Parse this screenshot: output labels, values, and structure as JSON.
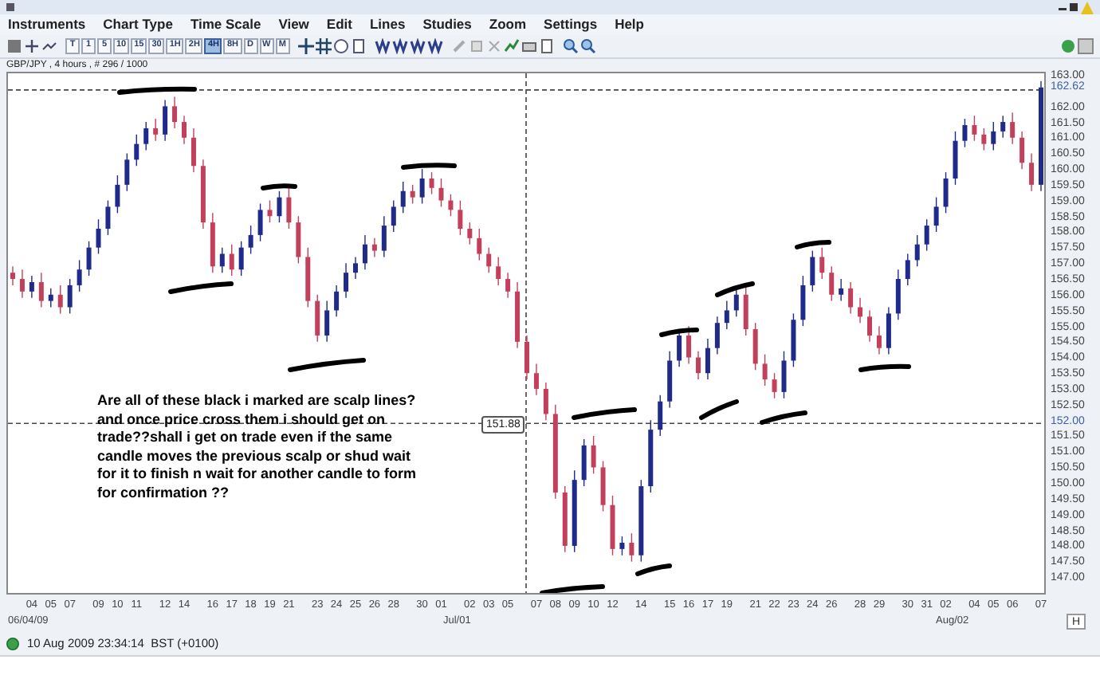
{
  "menu": [
    "Instruments",
    "Chart Type",
    "Time Scale",
    "View",
    "Edit",
    "Lines",
    "Studies",
    "Zoom",
    "Settings",
    "Help"
  ],
  "timeframes": [
    {
      "label": "T",
      "selected": false
    },
    {
      "label": "1",
      "selected": false
    },
    {
      "label": "5",
      "selected": false
    },
    {
      "label": "10",
      "selected": false
    },
    {
      "label": "15",
      "selected": false
    },
    {
      "label": "30",
      "selected": false
    },
    {
      "label": "1H",
      "selected": false
    },
    {
      "label": "2H",
      "selected": false
    },
    {
      "label": "4H",
      "selected": true
    },
    {
      "label": "8H",
      "selected": false
    },
    {
      "label": "D",
      "selected": false
    },
    {
      "label": "W",
      "selected": false
    },
    {
      "label": "M",
      "selected": false
    }
  ],
  "chart": {
    "heading": "GBP/JPY , 4 hours , # 296 / 1000",
    "chart_data": {
      "type": "candlestick",
      "ylim": [
        146.6,
        163.15
      ],
      "categories": [
        null,
        null,
        "04",
        null,
        "05",
        null,
        "07",
        null,
        null,
        "09",
        null,
        "10",
        null,
        "11",
        null,
        null,
        "12",
        null,
        "14",
        null,
        null,
        "16",
        null,
        "17",
        null,
        "18",
        null,
        "19",
        null,
        "21",
        null,
        null,
        "23",
        null,
        "24",
        null,
        "25",
        null,
        "26",
        null,
        "28",
        null,
        null,
        "30",
        null,
        "01",
        null,
        null,
        "02",
        null,
        "03",
        null,
        "05",
        null,
        null,
        "07",
        null,
        "08",
        null,
        "09",
        null,
        "10",
        null,
        "12",
        null,
        null,
        "14",
        null,
        null,
        "15",
        null,
        "16",
        null,
        "17",
        null,
        "19",
        null,
        null,
        "21",
        null,
        "22",
        null,
        "23",
        null,
        "24",
        null,
        "26",
        null,
        null,
        "28",
        null,
        "29",
        null,
        null,
        "30",
        null,
        "31",
        null,
        "02",
        null,
        null,
        "04",
        null,
        "05",
        null,
        "06",
        null,
        null,
        "07"
      ],
      "yticks": [
        {
          "value": 163,
          "label": "163.00"
        },
        {
          "value": 162,
          "label": "162.00"
        },
        {
          "value": 161.5,
          "label": "161.50"
        },
        {
          "value": 161,
          "label": "161.00"
        },
        {
          "value": 160.5,
          "label": "160.50"
        },
        {
          "value": 160,
          "label": "160.00"
        },
        {
          "value": 159.5,
          "label": "159.50"
        },
        {
          "value": 159,
          "label": "159.00"
        },
        {
          "value": 158.5,
          "label": "158.50"
        },
        {
          "value": 158,
          "label": "158.00"
        },
        {
          "value": 157.5,
          "label": "157.50"
        },
        {
          "value": 157,
          "label": "157.00"
        },
        {
          "value": 156.5,
          "label": "156.50"
        },
        {
          "value": 156,
          "label": "156.00"
        },
        {
          "value": 155.5,
          "label": "155.50"
        },
        {
          "value": 155,
          "label": "155.00"
        },
        {
          "value": 154.5,
          "label": "154.50"
        },
        {
          "value": 154,
          "label": "154.00"
        },
        {
          "value": 153.5,
          "label": "153.50"
        },
        {
          "value": 153,
          "label": "153.00"
        },
        {
          "value": 152.5,
          "label": "152.50"
        },
        {
          "value": 151.5,
          "label": "151.50"
        },
        {
          "value": 151,
          "label": "151.00"
        },
        {
          "value": 150.5,
          "label": "150.50"
        },
        {
          "value": 150,
          "label": "150.00"
        },
        {
          "value": 149.5,
          "label": "149.50"
        },
        {
          "value": 149,
          "label": "149.00"
        },
        {
          "value": 148.5,
          "label": "148.50"
        },
        {
          "value": 148,
          "label": "148.00"
        },
        {
          "value": 147.5,
          "label": "147.50"
        },
        {
          "value": 147,
          "label": "147.00"
        }
      ],
      "ohlc": [
        [
          156.8,
          157.0,
          156.4,
          156.6
        ],
        [
          156.6,
          156.9,
          156.0,
          156.2
        ],
        [
          156.2,
          156.7,
          156.0,
          156.5
        ],
        [
          156.5,
          156.8,
          155.7,
          155.9
        ],
        [
          155.9,
          156.3,
          155.7,
          156.1
        ],
        [
          156.1,
          156.4,
          155.5,
          155.7
        ],
        [
          155.7,
          156.6,
          155.5,
          156.4
        ],
        [
          156.4,
          157.2,
          156.2,
          156.9
        ],
        [
          156.9,
          157.8,
          156.7,
          157.6
        ],
        [
          157.6,
          158.5,
          157.4,
          158.2
        ],
        [
          158.2,
          159.1,
          158.0,
          158.9
        ],
        [
          158.9,
          159.9,
          158.7,
          159.6
        ],
        [
          159.6,
          160.6,
          159.4,
          160.4
        ],
        [
          160.4,
          161.2,
          160.2,
          160.9
        ],
        [
          160.9,
          161.6,
          160.7,
          161.4
        ],
        [
          161.4,
          161.7,
          161.0,
          161.2
        ],
        [
          161.2,
          162.3,
          161.0,
          162.1
        ],
        [
          162.1,
          162.4,
          161.4,
          161.6
        ],
        [
          161.6,
          161.8,
          160.9,
          161.1
        ],
        [
          161.1,
          161.4,
          160.0,
          160.2
        ],
        [
          160.2,
          160.4,
          158.2,
          158.4
        ],
        [
          158.4,
          158.7,
          156.8,
          157.0
        ],
        [
          157.0,
          157.6,
          156.8,
          157.4
        ],
        [
          157.4,
          157.7,
          156.7,
          156.9
        ],
        [
          156.9,
          157.8,
          156.7,
          157.6
        ],
        [
          157.6,
          158.3,
          157.4,
          158.0
        ],
        [
          158.0,
          159.0,
          157.8,
          158.8
        ],
        [
          158.8,
          159.1,
          158.4,
          158.6
        ],
        [
          158.6,
          159.4,
          158.4,
          159.2
        ],
        [
          159.2,
          159.5,
          158.2,
          158.4
        ],
        [
          158.4,
          158.6,
          157.1,
          157.3
        ],
        [
          157.3,
          157.6,
          155.7,
          155.9
        ],
        [
          155.9,
          156.1,
          154.6,
          154.8
        ],
        [
          154.8,
          155.9,
          154.6,
          155.6
        ],
        [
          155.6,
          156.4,
          155.4,
          156.2
        ],
        [
          156.2,
          157.1,
          156.0,
          156.8
        ],
        [
          156.8,
          157.3,
          156.6,
          157.1
        ],
        [
          157.1,
          158.0,
          156.9,
          157.7
        ],
        [
          157.7,
          157.9,
          157.3,
          157.5
        ],
        [
          157.5,
          158.6,
          157.3,
          158.3
        ],
        [
          158.3,
          159.1,
          158.1,
          158.9
        ],
        [
          158.9,
          159.7,
          158.7,
          159.4
        ],
        [
          159.4,
          159.6,
          159.0,
          159.2
        ],
        [
          159.2,
          160.1,
          159.0,
          159.8
        ],
        [
          159.8,
          160.0,
          159.3,
          159.5
        ],
        [
          159.5,
          159.8,
          158.9,
          159.1
        ],
        [
          159.1,
          159.3,
          158.6,
          158.8
        ],
        [
          158.8,
          159.1,
          158.0,
          158.2
        ],
        [
          158.2,
          158.4,
          157.7,
          157.9
        ],
        [
          157.9,
          158.2,
          157.2,
          157.4
        ],
        [
          157.4,
          157.6,
          156.8,
          157.0
        ],
        [
          157.0,
          157.3,
          156.4,
          156.6
        ],
        [
          156.6,
          156.8,
          156.0,
          156.2
        ],
        [
          156.2,
          156.5,
          154.4,
          154.6
        ],
        [
          154.6,
          154.8,
          153.4,
          153.6
        ],
        [
          153.6,
          153.9,
          152.9,
          153.1
        ],
        [
          153.1,
          153.3,
          152.1,
          152.3
        ],
        [
          152.3,
          152.6,
          149.6,
          149.8
        ],
        [
          149.8,
          150.0,
          147.9,
          148.1
        ],
        [
          148.1,
          150.5,
          147.9,
          150.2
        ],
        [
          150.2,
          151.5,
          150.0,
          151.3
        ],
        [
          151.3,
          151.6,
          150.4,
          150.6
        ],
        [
          150.6,
          150.8,
          149.2,
          149.4
        ],
        [
          149.4,
          149.7,
          147.8,
          148.0
        ],
        [
          148.0,
          148.4,
          147.8,
          148.2
        ],
        [
          148.2,
          148.5,
          147.6,
          147.8
        ],
        [
          147.8,
          150.2,
          147.6,
          150.0
        ],
        [
          150.0,
          152.1,
          149.8,
          151.8
        ],
        [
          151.8,
          152.9,
          151.6,
          152.7
        ],
        [
          152.7,
          154.3,
          152.5,
          154.0
        ],
        [
          154.0,
          155.0,
          153.8,
          154.8
        ],
        [
          154.8,
          155.1,
          153.9,
          154.1
        ],
        [
          154.1,
          154.3,
          153.4,
          153.6
        ],
        [
          153.6,
          154.7,
          153.4,
          154.4
        ],
        [
          154.4,
          155.4,
          154.2,
          155.2
        ],
        [
          155.2,
          155.9,
          155.0,
          155.6
        ],
        [
          155.6,
          156.3,
          155.4,
          156.1
        ],
        [
          156.1,
          156.4,
          154.8,
          155.0
        ],
        [
          155.0,
          155.2,
          153.7,
          153.9
        ],
        [
          153.9,
          154.2,
          153.2,
          153.4
        ],
        [
          153.4,
          153.6,
          152.8,
          153.0
        ],
        [
          153.0,
          154.3,
          152.8,
          154.0
        ],
        [
          154.0,
          155.5,
          153.8,
          155.3
        ],
        [
          155.3,
          156.7,
          155.1,
          156.4
        ],
        [
          156.4,
          157.5,
          156.2,
          157.3
        ],
        [
          157.3,
          157.6,
          156.6,
          156.8
        ],
        [
          156.8,
          157.0,
          155.9,
          156.1
        ],
        [
          156.1,
          156.6,
          155.9,
          156.3
        ],
        [
          156.3,
          156.5,
          155.5,
          155.7
        ],
        [
          155.7,
          156.0,
          155.2,
          155.4
        ],
        [
          155.4,
          155.6,
          154.6,
          154.8
        ],
        [
          154.8,
          155.1,
          154.2,
          154.4
        ],
        [
          154.4,
          155.7,
          154.2,
          155.5
        ],
        [
          155.5,
          156.9,
          155.3,
          156.6
        ],
        [
          156.6,
          157.4,
          156.4,
          157.2
        ],
        [
          157.2,
          158.0,
          157.0,
          157.7
        ],
        [
          157.7,
          158.5,
          157.5,
          158.3
        ],
        [
          158.3,
          159.2,
          158.1,
          158.9
        ],
        [
          158.9,
          160.0,
          158.7,
          159.8
        ],
        [
          159.8,
          161.3,
          159.6,
          161.0
        ],
        [
          161.0,
          161.7,
          160.8,
          161.5
        ],
        [
          161.5,
          161.8,
          161.0,
          161.2
        ],
        [
          161.2,
          161.4,
          160.7,
          160.9
        ],
        [
          160.9,
          161.6,
          160.7,
          161.3
        ],
        [
          161.3,
          161.8,
          161.1,
          161.6
        ],
        [
          161.6,
          161.9,
          160.9,
          161.1
        ],
        [
          161.1,
          161.3,
          160.1,
          160.3
        ],
        [
          160.3,
          160.6,
          159.4,
          159.6
        ],
        [
          159.6,
          162.9,
          159.4,
          162.7
        ]
      ]
    },
    "crosshair_label": "151.88",
    "price_markers": [
      "162.62",
      "152.00"
    ],
    "annotation": "Are all of these black i marked are scalp lines? and once price cross them i should get on trade??shall i get on trade even if the same candle moves the previous scalp or shud wait for it to finish n wait for another candle to form for confirmation ??",
    "period_labels": [
      "06/04/09",
      "Jul/01",
      "Aug/02"
    ],
    "corner_button": "H"
  },
  "status_bar": {
    "time": "10 Aug 2009 23:34:14  BST (+0100)"
  }
}
